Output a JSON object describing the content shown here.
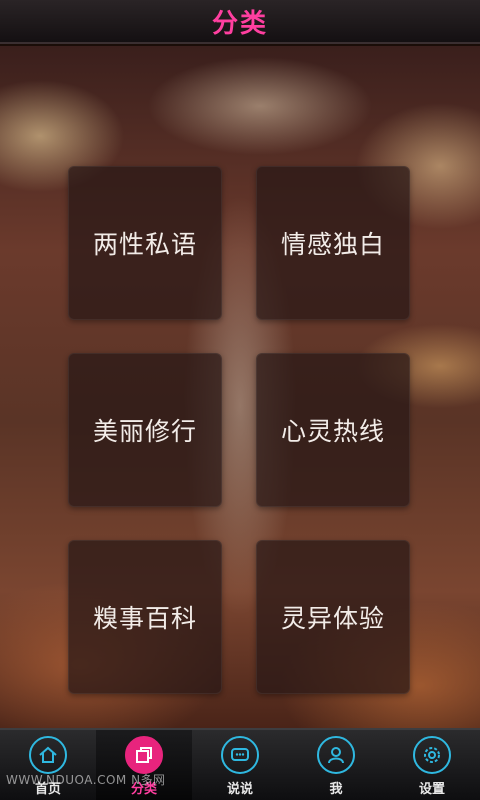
{
  "header": {
    "title": "分类"
  },
  "categories": [
    {
      "label": "两性私语"
    },
    {
      "label": "情感独白"
    },
    {
      "label": "美丽修行"
    },
    {
      "label": "心灵热线"
    },
    {
      "label": "糗事百科"
    },
    {
      "label": "灵异体验"
    }
  ],
  "tabbar": {
    "active": "分类",
    "items": [
      {
        "label": "首页",
        "icon": "home-icon"
      },
      {
        "label": "分类",
        "icon": "category-icon"
      },
      {
        "label": "说说",
        "icon": "chat-icon"
      },
      {
        "label": "我",
        "icon": "user-icon"
      },
      {
        "label": "设置",
        "icon": "settings-icon"
      }
    ]
  },
  "watermark": "WWW.NDUOA.COM N多网",
  "colors": {
    "accent": "#ff3fa0",
    "icon_ring": "#2fb8e0",
    "tab_active_bg": "#e8247d"
  }
}
